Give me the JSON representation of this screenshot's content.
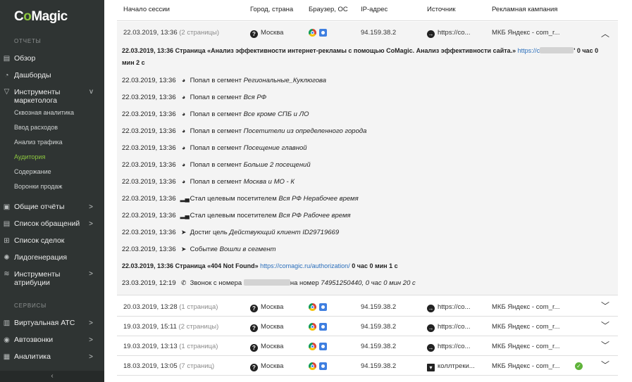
{
  "sidebar": {
    "logo_prefix": "C",
    "logo_o": "o",
    "logo_suffix": "Magic",
    "reports_title": "ОТЧЕТЫ",
    "overview": "Обзор",
    "dashboards": "Дашборды",
    "marketing_tools": "Инструменты маркетолога",
    "sub": [
      "Сквозная аналитика",
      "Ввод расходов",
      "Анализ трафика",
      "Аудитория",
      "Содержание",
      "Воронки продаж"
    ],
    "general_reports": "Общие отчёты",
    "requests": "Список обращений",
    "deals": "Список сделок",
    "leadgen": "Лидогенерация",
    "attribution": "Инструменты атрибуции",
    "services_title": "СЕРВИСЫ",
    "virtual_pbx": "Виртуальная АТС",
    "autocalls": "Автозвонки",
    "analytics": "Аналитика",
    "collapse": "‹"
  },
  "table": {
    "headers": [
      "Начало сессии",
      "Город, страна",
      "Браузер, ОС",
      "IP-адрес",
      "Источник",
      "Рекламная кампания"
    ]
  },
  "sessions": [
    {
      "start": "22.03.2019, 13:36",
      "pages": "(2 страницы)",
      "city": "Москва",
      "ip": "94.159.38.2",
      "source": "https://co...",
      "campaign": "МКБ Яндекс - com_r..."
    },
    {
      "start": "20.03.2019, 13:28",
      "pages": "(1 страница)",
      "city": "Москва",
      "ip": "94.159.38.2",
      "source": "https://co...",
      "campaign": "МКБ Яндекс - com_r..."
    },
    {
      "start": "19.03.2019, 15:11",
      "pages": "(2 страницы)",
      "city": "Москва",
      "ip": "94.159.38.2",
      "source": "https://co...",
      "campaign": "МКБ Яндекс - com_r..."
    },
    {
      "start": "19.03.2019, 13:13",
      "pages": "(1 страница)",
      "city": "Москва",
      "ip": "94.159.38.2",
      "source": "https://co...",
      "campaign": "МКБ Яндекс - com_r..."
    },
    {
      "start": "18.03.2019, 13:05",
      "pages": "(7 страниц)",
      "city": "Москва",
      "ip": "94.159.38.2",
      "source": "коллтреки...",
      "campaign": "МКБ Яндекс - com_r..."
    }
  ],
  "details": {
    "page1": {
      "text": "22.03.2019, 13:36 Страница «Анализ эффективности интернет-рекламы с помощью CoMagic. Анализ эффективности сайта.»",
      "link": "https://c",
      "duration": "' 0 час 0",
      "duration2": "мин 2 с"
    },
    "events": [
      {
        "time": "22.03.2019, 13:36",
        "icon": "pie",
        "action": "Попал в сегмент",
        "value": "Региональные_Куклюгова"
      },
      {
        "time": "22.03.2019, 13:36",
        "icon": "pie",
        "action": "Попал в сегмент",
        "value": "Вся РФ"
      },
      {
        "time": "22.03.2019, 13:36",
        "icon": "pie",
        "action": "Попал в сегмент",
        "value": "Все кроме СПБ и ЛО"
      },
      {
        "time": "22.03.2019, 13:36",
        "icon": "pie",
        "action": "Попал в сегмент",
        "value": "Посетители из определенного города"
      },
      {
        "time": "22.03.2019, 13:36",
        "icon": "pie",
        "action": "Попал в сегмент",
        "value": "Посещение главной"
      },
      {
        "time": "22.03.2019, 13:36",
        "icon": "pie",
        "action": "Попал в сегмент",
        "value": "Больше 2 посещений"
      },
      {
        "time": "22.03.2019, 13:36",
        "icon": "pie",
        "action": "Попал в сегмент",
        "value": "Москва и МО - К"
      },
      {
        "time": "22.03.2019, 13:36",
        "icon": "bars",
        "action": "Стал целевым посетителем",
        "value": "Вся РФ Нерабочее время"
      },
      {
        "time": "22.03.2019, 13:36",
        "icon": "bars",
        "action": "Стал целевым посетителем",
        "value": "Вся РФ Рабочее время"
      },
      {
        "time": "22.03.2019, 13:36",
        "icon": "cursor",
        "action": "Достиг цель",
        "value": "Действующий клиент ID29719669"
      },
      {
        "time": "22.03.2019, 13:36",
        "icon": "cursor",
        "action": "Событие",
        "value": "Вошли в сегмент"
      }
    ],
    "page2": {
      "text": "22.03.2019, 13:36 Страница «404 Not Found»",
      "link": "https://comagic.ru/authorization/",
      "duration": "0 час 0 мин 1 с"
    },
    "call": {
      "time": "23.03.2019, 12:19",
      "action": "Звонок с номера",
      "mid": "на номер",
      "value": "74951250440, 0 час 0 мин 20 с"
    }
  }
}
